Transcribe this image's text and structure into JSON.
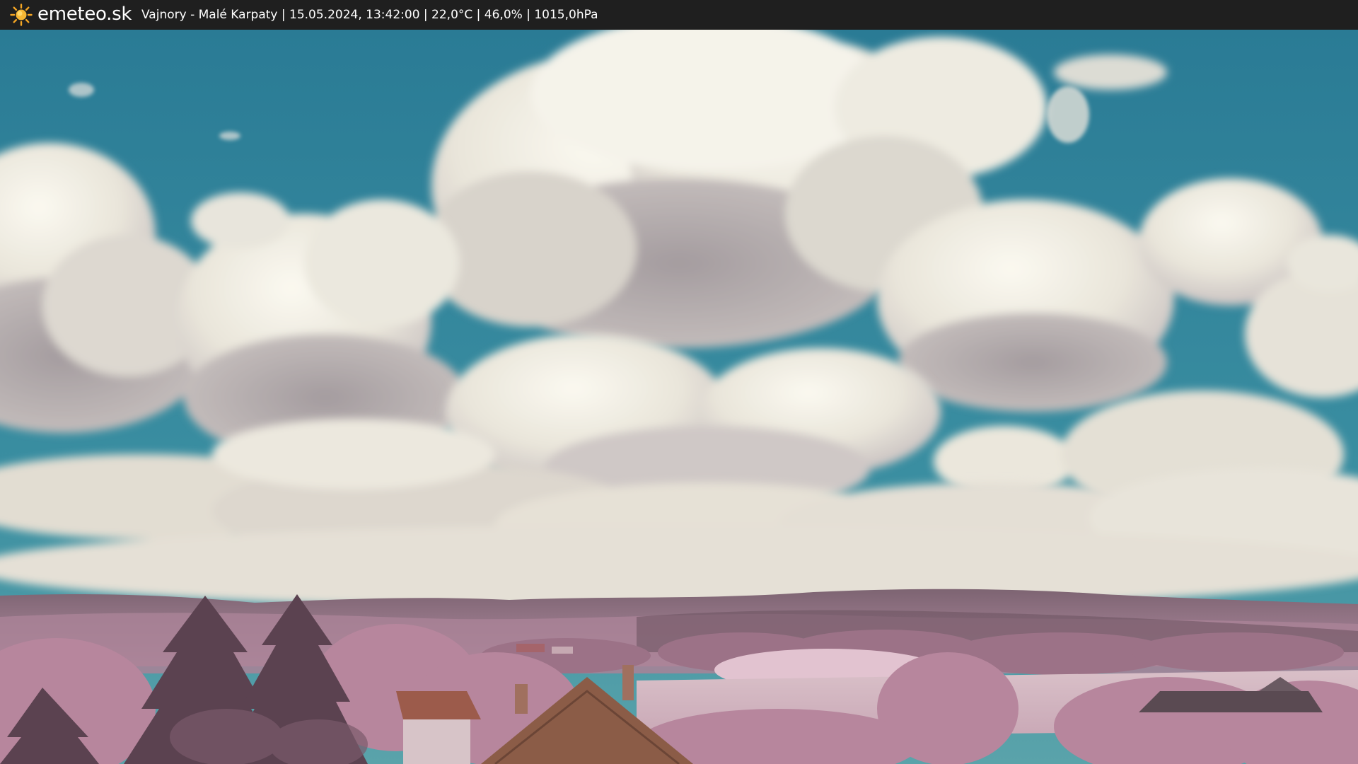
{
  "header": {
    "logo_icon": "sun-icon",
    "logo_text": "emeteo.sk",
    "station": "Vajnory - Malé Karpaty",
    "datetime": "15.05.2024, 13:42:00",
    "temperature": "22,0°C",
    "humidity": "46,0%",
    "pressure": "1015,0hPa",
    "info_line": "Vajnory - Malé Karpaty | 15.05.2024, 13:42:00 | 22,0°C | 46,0% | 1015,0hPa"
  },
  "image": {
    "description_colors": {
      "sky": "#2f7f96",
      "cloud": "#eeeae0",
      "cloud_shadow": "#a9a3a6",
      "foliage": "#b98aa0",
      "hills": "#8a6d7d",
      "roof": "#8a5a48"
    }
  }
}
